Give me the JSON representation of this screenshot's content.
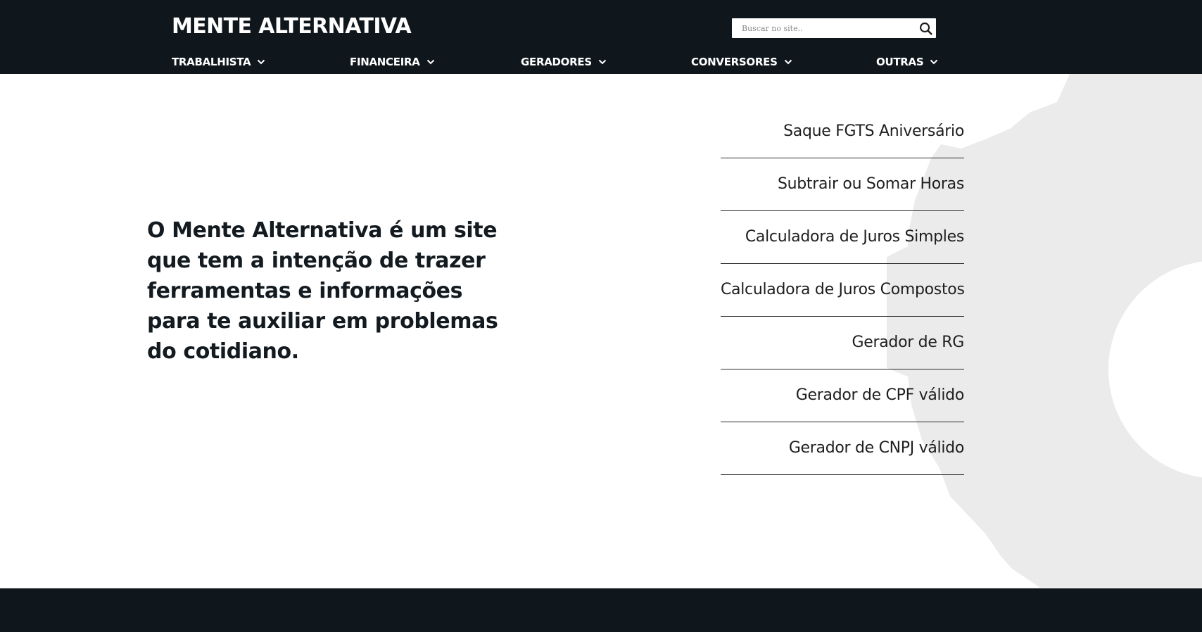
{
  "colors": {
    "header_bg": "#0f161c",
    "footer_bg": "#0f161c",
    "gear_bg": "#ebebeb",
    "text_dark": "#141b20"
  },
  "header": {
    "logo": "MENTE ALTERNATIVA",
    "search": {
      "placeholder": "Buscar no site..",
      "icon": "search-icon"
    },
    "nav": [
      {
        "label": "TRABALHISTA",
        "icon": "chevron-down-icon"
      },
      {
        "label": "FINANCEIRA",
        "icon": "chevron-down-icon"
      },
      {
        "label": "GERADORES",
        "icon": "chevron-down-icon"
      },
      {
        "label": "CONVERSORES",
        "icon": "chevron-down-icon"
      },
      {
        "label": "OUTRAS",
        "icon": "chevron-down-icon"
      }
    ]
  },
  "main": {
    "intro": "O Mente Alternativa é um site que tem a intenção de trazer ferramentas e informações para te auxiliar em problemas do cotidiano.",
    "links": [
      "Saque FGTS Aniversário",
      "Subtrair ou Somar Horas",
      "Calculadora de Juros Simples",
      "Calculadora de Juros Compostos",
      "Gerador de RG",
      "Gerador de CPF válido",
      "Gerador de CNPJ válido"
    ],
    "background_decoration": "gear-icon"
  }
}
